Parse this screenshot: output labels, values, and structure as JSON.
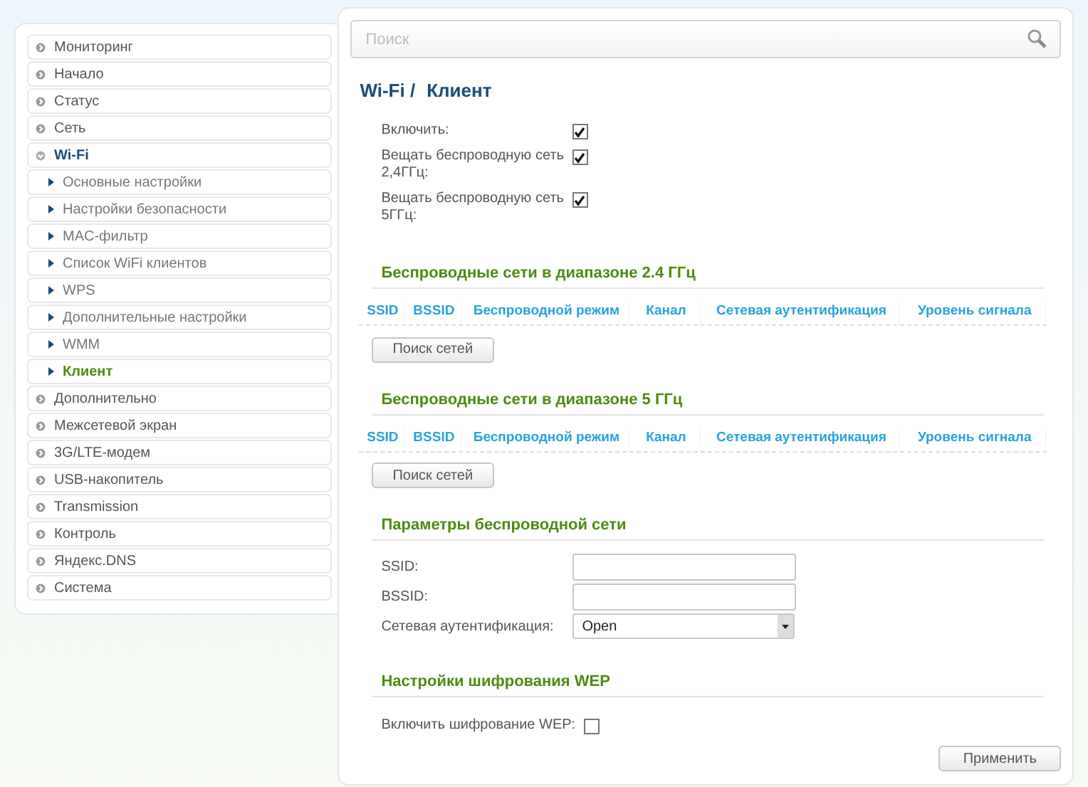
{
  "sidebar": {
    "items": [
      {
        "label": "Мониторинг",
        "selected": false,
        "expanded": false
      },
      {
        "label": "Начало",
        "selected": false,
        "expanded": false
      },
      {
        "label": "Статус",
        "selected": false,
        "expanded": false
      },
      {
        "label": "Сеть",
        "selected": false,
        "expanded": false
      },
      {
        "label": "Wi-Fi",
        "selected": false,
        "expanded": true,
        "children": [
          {
            "label": "Основные настройки",
            "selected": false
          },
          {
            "label": "Настройки безопасности",
            "selected": false
          },
          {
            "label": "MAC-фильтр",
            "selected": false
          },
          {
            "label": "Список WiFi клиентов",
            "selected": false
          },
          {
            "label": "WPS",
            "selected": false
          },
          {
            "label": "Дополнительные настройки",
            "selected": false
          },
          {
            "label": "WMM",
            "selected": false
          },
          {
            "label": "Клиент",
            "selected": true
          }
        ]
      },
      {
        "label": "Дополнительно",
        "selected": false,
        "expanded": false
      },
      {
        "label": "Межсетевой экран",
        "selected": false,
        "expanded": false
      },
      {
        "label": "3G/LTE-модем",
        "selected": false,
        "expanded": false
      },
      {
        "label": "USB-накопитель",
        "selected": false,
        "expanded": false
      },
      {
        "label": "Transmission",
        "selected": false,
        "expanded": false
      },
      {
        "label": "Контроль",
        "selected": false,
        "expanded": false
      },
      {
        "label": "Яндекс.DNS",
        "selected": false,
        "expanded": false
      },
      {
        "label": "Система",
        "selected": false,
        "expanded": false
      }
    ]
  },
  "search": {
    "placeholder": "Поиск"
  },
  "breadcrumb": [
    "Wi-Fi /",
    "Клиент"
  ],
  "toggles": [
    {
      "label": "Включить:",
      "checked": true
    },
    {
      "label": "Вещать беспроводную сеть 2,4ГГц:",
      "checked": true
    },
    {
      "label": "Вещать беспроводную сеть 5ГГц:",
      "checked": true
    }
  ],
  "scan_sections": [
    {
      "title": "Беспроводные сети в диапазоне 2.4 ГГц",
      "columns": [
        "SSID",
        "BSSID",
        "Беспроводной режим",
        "Канал",
        "Сетевая аутентификация",
        "Уровень сигнала"
      ],
      "button": "Поиск сетей"
    },
    {
      "title": "Беспроводные сети в диапазоне 5 ГГц",
      "columns": [
        "SSID",
        "BSSID",
        "Беспроводной режим",
        "Канал",
        "Сетевая аутентификация",
        "Уровень сигнала"
      ],
      "button": "Поиск сетей"
    }
  ],
  "params": {
    "title": "Параметры беспроводной сети",
    "fields": [
      {
        "kind": "text",
        "label": "SSID:"
      },
      {
        "kind": "text",
        "label": "BSSID:"
      },
      {
        "kind": "select",
        "label": "Сетевая аутентификация:",
        "value": "Open"
      }
    ]
  },
  "wep": {
    "title": "Настройки шифрования WEP",
    "label": "Включить шифрование WEP:",
    "checked": false
  },
  "apply_button": "Применить"
}
